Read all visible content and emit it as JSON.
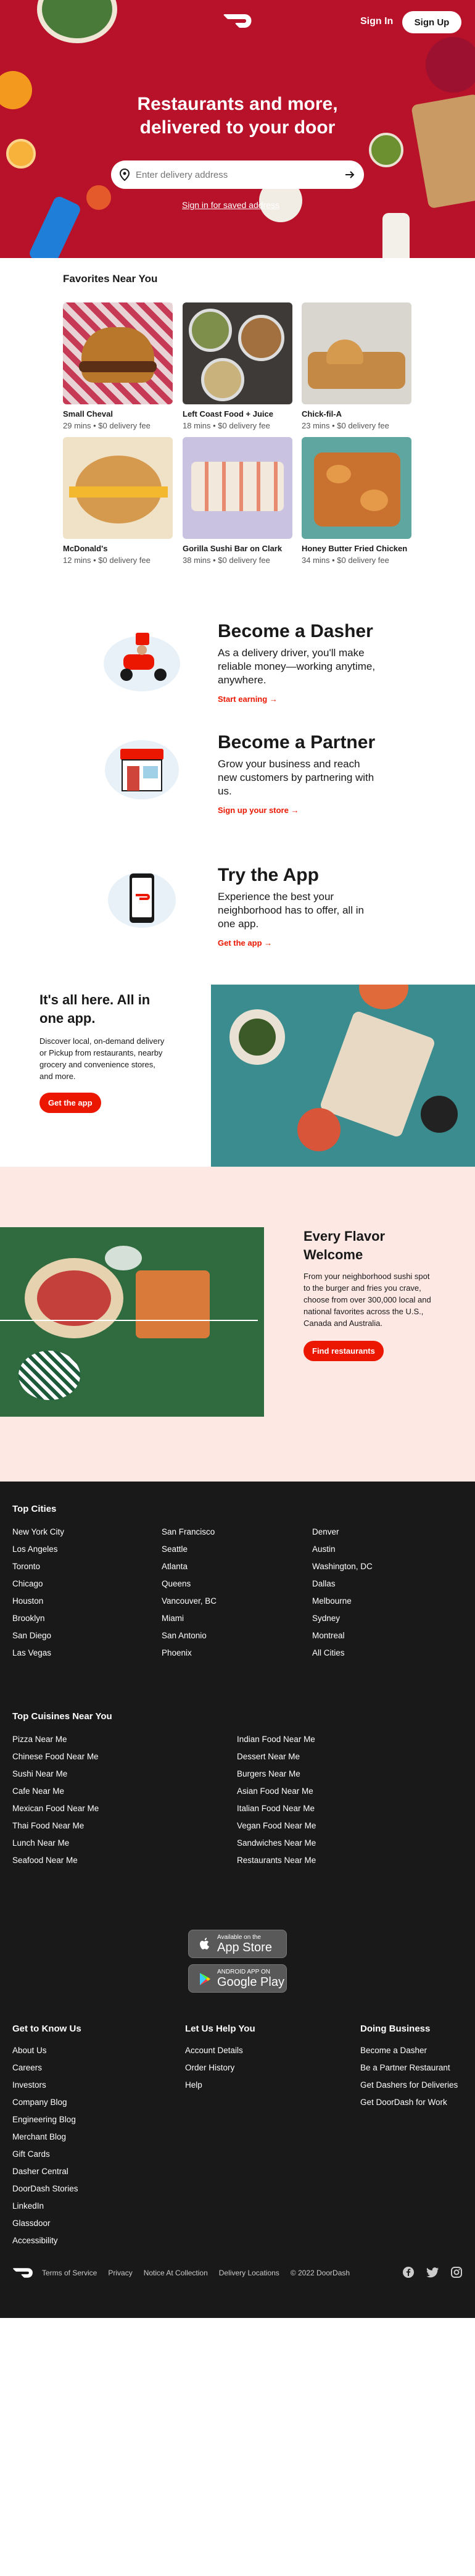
{
  "header": {
    "signin_label": "Sign In",
    "signup_label": "Sign Up",
    "title_line1": "Restaurants and more,",
    "title_line2": "delivered to your door",
    "address_placeholder": "Enter delivery address",
    "signin_save_label": "Sign in for saved address"
  },
  "favorites": {
    "title": "Favorites Near You",
    "items": [
      {
        "name": "Small Cheval",
        "meta": "29 mins • $0 delivery fee"
      },
      {
        "name": "Left Coast Food + Juice",
        "meta": "18 mins • $0 delivery fee"
      },
      {
        "name": "Chick-fil-A",
        "meta": "23 mins • $0 delivery fee"
      },
      {
        "name": "McDonald's",
        "meta": "12 mins • $0 delivery fee"
      },
      {
        "name": "Gorilla Sushi Bar on Clark",
        "meta": "38 mins • $0 delivery fee"
      },
      {
        "name": "Honey Butter Fried Chicken",
        "meta": "34 mins • $0 delivery fee"
      }
    ]
  },
  "features": [
    {
      "title": "Become a Dasher",
      "text": "As a delivery driver, you'll make reliable money—working anytime, anywhere.",
      "link": "Start earning"
    },
    {
      "title": "Become a Partner",
      "text": "Grow your business and reach new customers by partnering with us.",
      "link": "Sign up your store"
    },
    {
      "title": "Try the App",
      "text": "Experience the best your neighborhood has to offer, all in one app.",
      "link": "Get the app"
    }
  ],
  "promo1": {
    "title": "It's all here. All in one app.",
    "text": "Discover local, on-demand delivery or Pickup from restaurants, nearby grocery and convenience stores, and more.",
    "button": "Get the app"
  },
  "promo2": {
    "title": "Every Flavor Welcome",
    "text": "From your neighborhood sushi spot to the burger and fries you crave, choose from over 300,000 local and national favorites across the U.S., Canada and Australia.",
    "button": "Find restaurants"
  },
  "footer": {
    "top_cities_title": "Top Cities",
    "cities_col1": [
      "New York City",
      "Los Angeles",
      "Toronto",
      "Chicago",
      "Houston",
      "Brooklyn",
      "San Diego",
      "Las Vegas"
    ],
    "cities_col2": [
      "San Francisco",
      "Seattle",
      "Atlanta",
      "Queens",
      "Vancouver, BC",
      "Miami",
      "San Antonio",
      "Phoenix"
    ],
    "cities_col3": [
      "Denver",
      "Austin",
      "Washington, DC",
      "Dallas",
      "Melbourne",
      "Sydney",
      "Montreal",
      "All Cities"
    ],
    "cuisines_title": "Top Cuisines Near You",
    "cuisines_col1": [
      "Pizza Near Me",
      "Chinese Food Near Me",
      "Sushi Near Me",
      "Cafe Near Me",
      "Mexican Food Near Me",
      "Thai Food Near Me",
      "Lunch Near Me",
      "Seafood Near Me"
    ],
    "cuisines_col2": [
      "Indian Food Near Me",
      "Dessert Near Me",
      "Burgers Near Me",
      "Asian Food Near Me",
      "Italian Food Near Me",
      "Vegan Food Near Me",
      "Sandwiches Near Me",
      "Restaurants Near Me"
    ],
    "app_store_small": "Available on the",
    "app_store_big": "App Store",
    "google_play_small": "ANDROID APP ON",
    "google_play_big": "Google Play",
    "know_us_title": "Get to Know Us",
    "know_us": [
      "About Us",
      "Careers",
      "Investors",
      "Company Blog",
      "Engineering Blog",
      "Merchant Blog",
      "Gift Cards",
      "Dasher Central",
      "DoorDash Stories",
      "LinkedIn",
      "Glassdoor",
      "Accessibility"
    ],
    "help_title": "Let Us Help You",
    "help": [
      "Account Details",
      "Order History",
      "Help"
    ],
    "business_title": "Doing Business",
    "business": [
      "Become a Dasher",
      "Be a Partner Restaurant",
      "Get Dashers for Deliveries",
      "Get DoorDash for Work"
    ],
    "bottom_links": [
      "Terms of Service",
      "Privacy",
      "Notice At Collection",
      "Delivery Locations",
      "© 2022 DoorDash"
    ]
  }
}
